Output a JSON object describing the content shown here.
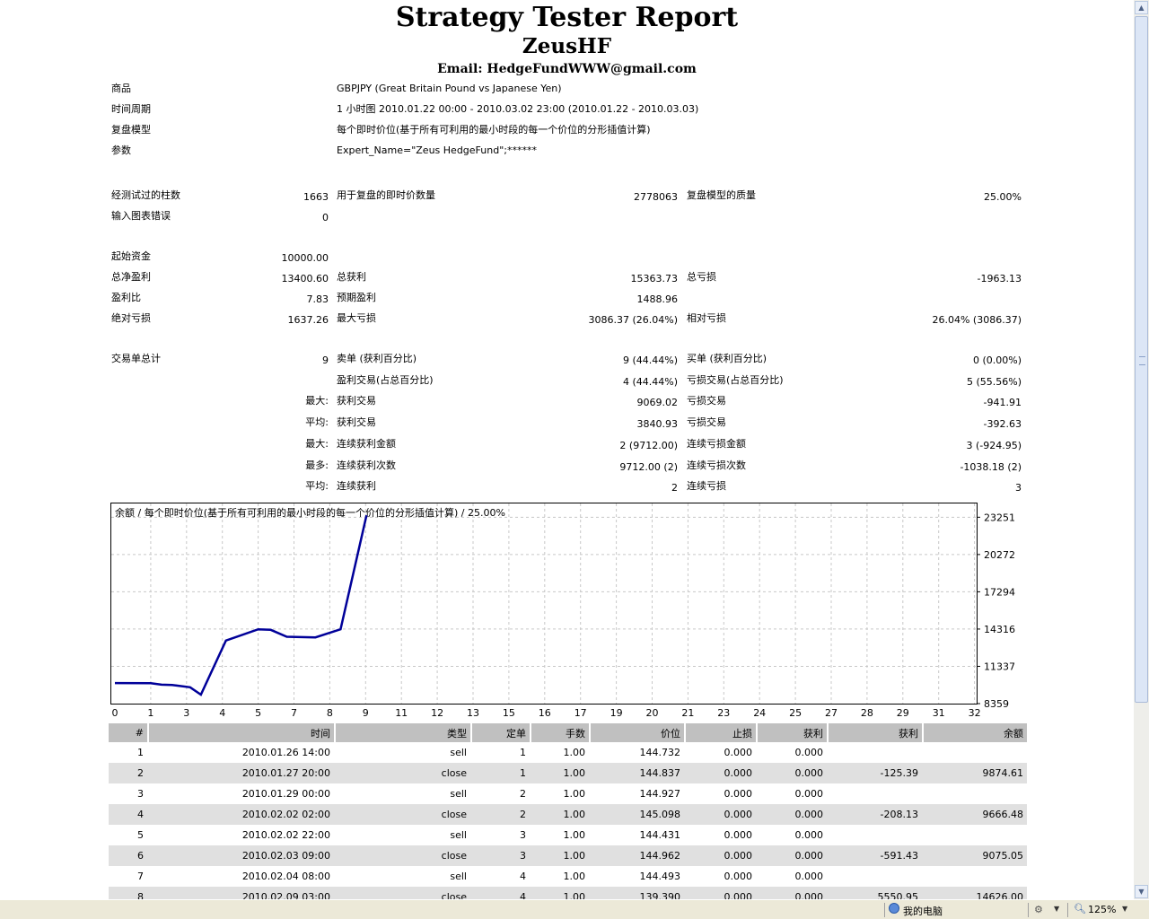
{
  "report": {
    "title": "Strategy Tester Report",
    "name": "ZeusHF",
    "email": "Email: HedgeFundWWW@gmail.com"
  },
  "info": [
    {
      "label": "商品",
      "value": "GBPJPY (Great Britain Pound vs Japanese Yen)"
    },
    {
      "label": "时间周期",
      "value": "1 小时图  2010.01.22 00:00 - 2010.03.02 23:00 (2010.01.22 - 2010.03.03)"
    },
    {
      "label": "复盘模型",
      "value": "每个即时价位(基于所有可利用的最小时段的每一个价位的分形插值计算)"
    },
    {
      "label": "参数",
      "value": "Expert_Name=\"Zeus HedgeFund\";******"
    }
  ],
  "stats": {
    "bars_label": "经测试过的柱数",
    "bars": "1663",
    "ticks_label": "用于复盘的即时价数量",
    "ticks": "2778063",
    "quality_label": "复盘模型的质量",
    "quality": "25.00%",
    "errors_label": "输入图表错误",
    "errors": "0",
    "deposit_label": "起始资金",
    "deposit": "10000.00",
    "net_label": "总净盈利",
    "net": "13400.60",
    "gross_profit_label": "总获利",
    "gross_profit": "15363.73",
    "gross_loss_label": "总亏损",
    "gross_loss": "-1963.13",
    "pf_label": "盈利比",
    "pf": "7.83",
    "payoff_label": "预期盈利",
    "payoff": "1488.96",
    "abs_dd_label": "绝对亏损",
    "abs_dd": "1637.26",
    "max_dd_label": "最大亏损",
    "max_dd": "3086.37 (26.04%)",
    "rel_dd_label": "相对亏损",
    "rel_dd": "26.04% (3086.37)",
    "total_trades_label": "交易单总计",
    "total_trades": "9",
    "short_label": "卖单 (获利百分比)",
    "short": "9 (44.44%)",
    "long_label": "买单 (获利百分比)",
    "long": "0 (0.00%)",
    "profit_trades_label": "盈利交易(占总百分比)",
    "profit_trades": "4 (44.44%)",
    "loss_trades_label": "亏损交易(占总百分比)",
    "loss_trades": "5 (55.56%)",
    "rows": [
      {
        "prefix": "最大:",
        "l1": "获利交易",
        "v1": "9069.02",
        "l2": "亏损交易",
        "v2": "-941.91"
      },
      {
        "prefix": "平均:",
        "l1": "获利交易",
        "v1": "3840.93",
        "l2": "亏损交易",
        "v2": "-392.63"
      },
      {
        "prefix": "最大:",
        "l1": "连续获利金额",
        "v1": "2 (9712.00)",
        "l2": "连续亏损金额",
        "v2": "3 (-924.95)"
      },
      {
        "prefix": "最多:",
        "l1": "连续获利次数",
        "v1": "9712.00 (2)",
        "l2": "连续亏损次数",
        "v2": "-1038.18 (2)"
      },
      {
        "prefix": "平均:",
        "l1": "连续获利",
        "v1": "2",
        "l2": "连续亏损",
        "v2": "3"
      }
    ]
  },
  "chart_data": {
    "type": "line",
    "title": "余额 / 每个即时价位(基于所有可利用的最小时段的每一个价位的分形插值计算) / 25.00%",
    "x_ticks": [
      0,
      1,
      3,
      4,
      5,
      7,
      8,
      9,
      11,
      12,
      13,
      15,
      16,
      17,
      19,
      20,
      21,
      23,
      24,
      25,
      27,
      28,
      29,
      31,
      32
    ],
    "y_ticks": [
      23251,
      20272,
      17294,
      14316,
      11337,
      8359
    ],
    "xlim": [
      0,
      32.2
    ],
    "ylim": [
      8359,
      24350
    ],
    "grid": true,
    "series": [
      {
        "color": "#000099",
        "x": [
          0,
          1,
          1.6,
          2.2,
          3.1,
          3.4,
          4.1,
          5.0,
          5.7,
          6.6,
          7.6,
          8.3,
          9.05
        ],
        "y": [
          10000,
          9990,
          9874.61,
          9850,
          9666.48,
          9075.05,
          13400,
          14300,
          14250,
          13700,
          13650,
          14300,
          23400
        ]
      }
    ],
    "color": "#000099"
  },
  "table": {
    "headers": [
      "#",
      "时间",
      "类型",
      "定单",
      "手数",
      "价位",
      "止损",
      "获利",
      "获利",
      "余额"
    ],
    "rows": [
      [
        "1",
        "2010.01.26 14:00",
        "sell",
        "1",
        "1.00",
        "144.732",
        "0.000",
        "0.000",
        "",
        ""
      ],
      [
        "2",
        "2010.01.27 20:00",
        "close",
        "1",
        "1.00",
        "144.837",
        "0.000",
        "0.000",
        "-125.39",
        "9874.61"
      ],
      [
        "3",
        "2010.01.29 00:00",
        "sell",
        "2",
        "1.00",
        "144.927",
        "0.000",
        "0.000",
        "",
        ""
      ],
      [
        "4",
        "2010.02.02 02:00",
        "close",
        "2",
        "1.00",
        "145.098",
        "0.000",
        "0.000",
        "-208.13",
        "9666.48"
      ],
      [
        "5",
        "2010.02.02 22:00",
        "sell",
        "3",
        "1.00",
        "144.431",
        "0.000",
        "0.000",
        "",
        ""
      ],
      [
        "6",
        "2010.02.03 09:00",
        "close",
        "3",
        "1.00",
        "144.962",
        "0.000",
        "0.000",
        "-591.43",
        "9075.05"
      ],
      [
        "7",
        "2010.02.04 08:00",
        "sell",
        "4",
        "1.00",
        "144.493",
        "0.000",
        "0.000",
        "",
        ""
      ],
      [
        "8",
        "2010.02.09 03:00",
        "close",
        "4",
        "1.00",
        "139.390",
        "0.000",
        "0.000",
        "5550.95",
        "14626.00"
      ]
    ]
  },
  "statusbar": {
    "zone": "我的电脑",
    "zoom": "125%"
  }
}
